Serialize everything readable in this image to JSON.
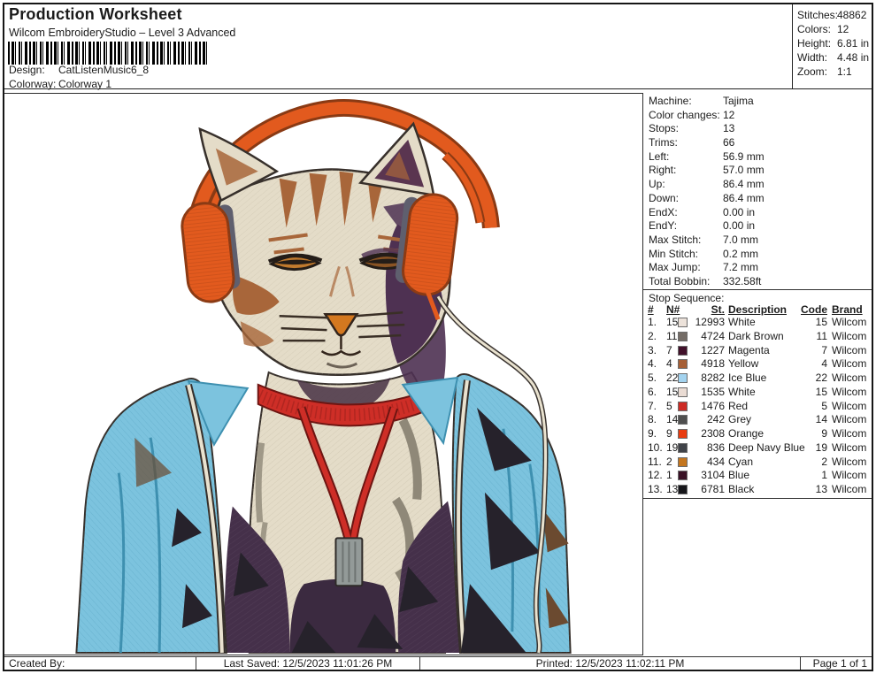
{
  "header": {
    "title": "Production Worksheet",
    "subtitle": "Wilcom EmbroideryStudio – Level 3 Advanced",
    "design_label": "Design:",
    "design_value": "CatListenMusic6_8",
    "colorway_label": "Colorway:",
    "colorway_value": "Colorway 1",
    "stats": [
      {
        "label": "Stitches:",
        "value": "48862"
      },
      {
        "label": "Colors:",
        "value": "12"
      },
      {
        "label": "Height:",
        "value": "6.81 in"
      },
      {
        "label": "Width:",
        "value": "4.48 in"
      },
      {
        "label": "Zoom:",
        "value": "1:1"
      }
    ]
  },
  "machine_info": [
    {
      "label": "Machine:",
      "value": "Tajima"
    },
    {
      "label": "Color changes:",
      "value": "12"
    },
    {
      "label": "Stops:",
      "value": "13"
    },
    {
      "label": "Trims:",
      "value": "66"
    },
    {
      "label": "Left:",
      "value": "56.9 mm"
    },
    {
      "label": "Right:",
      "value": "57.0 mm"
    },
    {
      "label": "Up:",
      "value": "86.4 mm"
    },
    {
      "label": "Down:",
      "value": "86.4 mm"
    },
    {
      "label": "EndX:",
      "value": "0.00 in"
    },
    {
      "label": "EndY:",
      "value": "0.00 in"
    },
    {
      "label": "Max Stitch:",
      "value": "7.0 mm"
    },
    {
      "label": "Min Stitch:",
      "value": "0.2 mm"
    },
    {
      "label": "Max Jump:",
      "value": "7.2 mm"
    },
    {
      "label": "Total Bobbin:",
      "value": "332.58ft"
    }
  ],
  "stop_sequence": {
    "heading": "Stop Sequence:",
    "columns": {
      "num": "#",
      "n": "N#",
      "st": "St.",
      "description": "Description",
      "code": "Code",
      "brand": "Brand"
    },
    "rows": [
      {
        "num": "1.",
        "n": "15",
        "color": "#ece2da",
        "st": "12993",
        "description": "White",
        "code": "15",
        "brand": "Wilcom"
      },
      {
        "num": "2.",
        "n": "11",
        "color": "#746c66",
        "st": "4724",
        "description": "Dark Brown",
        "code": "11",
        "brand": "Wilcom"
      },
      {
        "num": "3.",
        "n": "7",
        "color": "#41112a",
        "st": "1227",
        "description": "Magenta",
        "code": "7",
        "brand": "Wilcom"
      },
      {
        "num": "4.",
        "n": "4",
        "color": "#a65f36",
        "st": "4918",
        "description": "Yellow",
        "code": "4",
        "brand": "Wilcom"
      },
      {
        "num": "5.",
        "n": "22",
        "color": "#a3d3ef",
        "st": "8282",
        "description": "Ice Blue",
        "code": "22",
        "brand": "Wilcom"
      },
      {
        "num": "6.",
        "n": "15",
        "color": "#eadcd4",
        "st": "1535",
        "description": "White",
        "code": "15",
        "brand": "Wilcom"
      },
      {
        "num": "7.",
        "n": "5",
        "color": "#cd2a24",
        "st": "1476",
        "description": "Red",
        "code": "5",
        "brand": "Wilcom"
      },
      {
        "num": "8.",
        "n": "14",
        "color": "#4f4f4f",
        "st": "242",
        "description": "Grey",
        "code": "14",
        "brand": "Wilcom"
      },
      {
        "num": "9.",
        "n": "9",
        "color": "#e83c10",
        "st": "2308",
        "description": "Orange",
        "code": "9",
        "brand": "Wilcom"
      },
      {
        "num": "10.",
        "n": "19",
        "color": "#404349",
        "st": "836",
        "description": "Deep Navy Blue",
        "code": "19",
        "brand": "Wilcom"
      },
      {
        "num": "11.",
        "n": "2",
        "color": "#c4761f",
        "st": "434",
        "description": "Cyan",
        "code": "2",
        "brand": "Wilcom"
      },
      {
        "num": "12.",
        "n": "1",
        "color": "#391125",
        "st": "3104",
        "description": "Blue",
        "code": "1",
        "brand": "Wilcom"
      },
      {
        "num": "13.",
        "n": "13",
        "color": "#17171b",
        "st": "6781",
        "description": "Black",
        "code": "13",
        "brand": "Wilcom"
      }
    ]
  },
  "footer": {
    "created_by": "Created By:",
    "last_saved": "Last Saved: 12/5/2023 11:01:26 PM",
    "printed": "Printed: 12/5/2023 11:02:11 PM",
    "page": "Page 1 of 1"
  },
  "artwork": {
    "alt": "Embroidered tabby cat wearing orange headphones and an ice blue hoodie with red drawstring",
    "palette": {
      "orange": "#e25a1e",
      "orange_dark": "#8a3a14",
      "cream": "#e4dcc8",
      "cream_light": "#efe9d9",
      "rust": "#a8663a",
      "purple": "#4e3152",
      "grey": "#8f8878",
      "slate": "#5f5f6e",
      "blue": "#7cc3de",
      "blue_dark": "#3e90b0",
      "red": "#ce2e27",
      "red_dark": "#6e1512",
      "shirt": "#45304a",
      "black": "#26222b",
      "outline": "#37302b",
      "cable": "#e9e2cf",
      "aglet": "#939a98",
      "amber": "#c07a2e"
    }
  }
}
